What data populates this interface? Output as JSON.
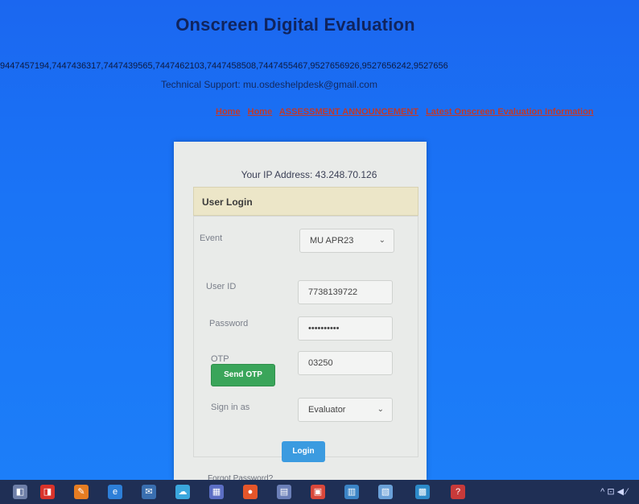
{
  "header": {
    "title": "Onscreen Digital Evaluation",
    "phones": "9447457194,7447436317,7447439565,7447462103,7447458508,7447455467,9527656926,9527656242,9527656",
    "support": "Technical Support: mu.osdeshelpdesk@gmail.com",
    "nav": [
      "Home",
      "Home",
      "ASSESSMENT ANNOUNCEMENT",
      "Latest Onscreen Evaluation Information"
    ]
  },
  "card": {
    "ip": "Your IP Address: 43.248.70.126",
    "heading": "User Login",
    "event_label": "Event",
    "event_value": "MU APR23",
    "userid_label": "User ID",
    "userid_value": "7738139722",
    "password_label": "Password",
    "password_value": "••••••••••",
    "otp_label": "OTP",
    "otp_value": "03250",
    "send_otp": "Send OTP",
    "signin_label": "Sign in as",
    "signin_value": "Evaluator",
    "login": "Login",
    "forgot": "Forgot Password?"
  },
  "taskbar": {
    "icons": [
      "windows-icon",
      "pdf-icon",
      "paint-icon",
      "edge-icon",
      "mail-icon",
      "cloud-icon",
      "teams-icon",
      "firefox-icon",
      "calculator-icon",
      "photos-icon",
      "store-icon",
      "files-icon",
      "chart-icon",
      "help-icon"
    ],
    "tray": "^ ⊡ ◀ ∕"
  }
}
